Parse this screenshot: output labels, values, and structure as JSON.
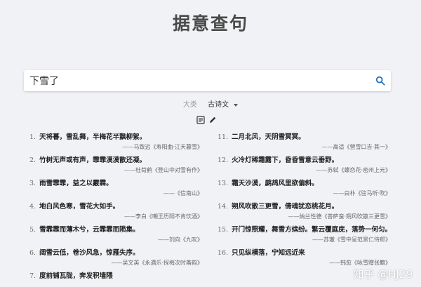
{
  "header": {
    "title": "据意查句"
  },
  "search": {
    "value": "下雪了"
  },
  "filter": {
    "label": "大类",
    "selected": "古诗文"
  },
  "results_left": [
    {
      "num": "1.",
      "text": "天将暮，雪乱舞，半梅花半飘柳絮。",
      "source": "——马致远《寿阳曲·江天暮雪》"
    },
    {
      "num": "2.",
      "text": "竹树无声或有声，霏霏漠漠散还凝。",
      "source": "——杜荀鹤《登山中对雪有作》"
    },
    {
      "num": "3.",
      "text": "雨雪霏霏，益之以霰霖。",
      "source": "——《信南山》"
    },
    {
      "num": "4.",
      "text": "地白风色寒，雪花大如手。",
      "source": "——李白《嘲王历阳不肯饮酒》"
    },
    {
      "num": "5.",
      "text": "雪霏霏而薄木兮，云霏霏而陨集。",
      "source": "——刘向《九叹》"
    },
    {
      "num": "6.",
      "text": "阔雪云低，卷沙风急，惊雁失序。",
      "source": "——吴文英《永遇乐·探梅次时斋韵》"
    },
    {
      "num": "7.",
      "text": "度前铺瓦陇，奔发积墙隈",
      "source": ""
    }
  ],
  "results_right": [
    {
      "num": "11.",
      "text": "二月北风，天阴雪冥冥。",
      "source": "——高适《营雪口吉·其一》"
    },
    {
      "num": "12.",
      "text": "火冷灯稀霜露下，昏昏雪意云垂野。",
      "source": "——苏轼《蝶恋花·密州上元》"
    },
    {
      "num": "13.",
      "text": "霜天沙漠，鹧鸪风里欲偏斜。",
      "source": "——白朴《驻马听·吹》"
    },
    {
      "num": "14.",
      "text": "朔风吹散三更雪，倩魂犹恋桃花月。",
      "source": "——纳兰性德《菩萨蛮·朔风吹散三更雪》"
    },
    {
      "num": "15.",
      "text": "开门惊照耀，舞雪方缤纷。繁云覆庭庑，落势一何匀。",
      "source": "——苏辙《雪中呈范景仁侍郎》"
    },
    {
      "num": "16.",
      "text": "只见纵横落，宁知远近来",
      "source": "——韩愈《咏雪赠张籍》"
    }
  ],
  "watermark": "知乎 @HJ29",
  "colors": {
    "background": "#f1f2f5",
    "accent": "#1e6fbe"
  }
}
